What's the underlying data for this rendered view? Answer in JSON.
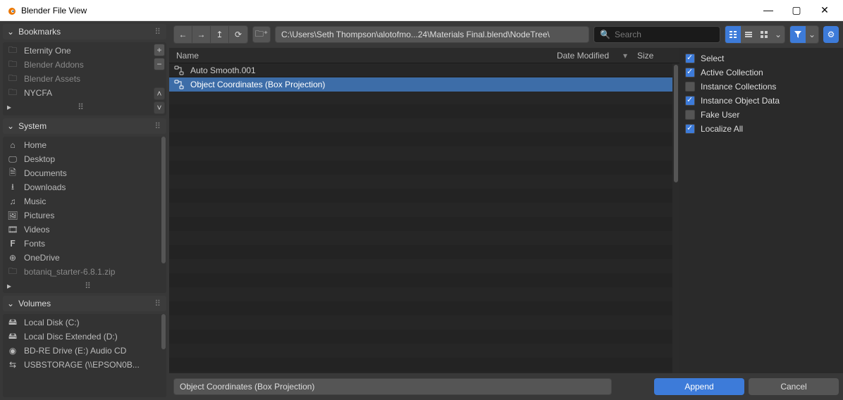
{
  "window": {
    "title": "Blender File View"
  },
  "sidebar": {
    "bookmarks": {
      "header": "Bookmarks",
      "items": [
        {
          "label": "Eternity One",
          "dim": false
        },
        {
          "label": "Blender Addons",
          "dim": true
        },
        {
          "label": "Blender Assets",
          "dim": true
        },
        {
          "label": "NYCFA",
          "dim": false
        }
      ]
    },
    "system": {
      "header": "System",
      "items": [
        {
          "icon": "home",
          "label": "Home"
        },
        {
          "icon": "desktop",
          "label": "Desktop"
        },
        {
          "icon": "documents",
          "label": "Documents"
        },
        {
          "icon": "downloads",
          "label": "Downloads"
        },
        {
          "icon": "music",
          "label": "Music"
        },
        {
          "icon": "pictures",
          "label": "Pictures"
        },
        {
          "icon": "videos",
          "label": "Videos"
        },
        {
          "icon": "fonts",
          "label": "Fonts"
        },
        {
          "icon": "cloud",
          "label": "OneDrive"
        },
        {
          "icon": "folder",
          "label": "botaniq_starter-6.8.1.zip",
          "dim": true
        }
      ]
    },
    "volumes": {
      "header": "Volumes",
      "items": [
        {
          "icon": "disk",
          "label": "Local Disk (C:)"
        },
        {
          "icon": "disk",
          "label": "Local Disc Extended (D:)"
        },
        {
          "icon": "optical",
          "label": "BD-RE Drive (E:) Audio CD"
        },
        {
          "icon": "usb",
          "label": "USBSTORAGE (\\\\EPSON0B..."
        }
      ]
    }
  },
  "toolbar": {
    "path": "C:\\Users\\Seth Thompson\\alotofmo...24\\Materials Final.blend\\NodeTree\\",
    "search_placeholder": "Search"
  },
  "columns": {
    "name": "Name",
    "date": "Date Modified",
    "size": "Size"
  },
  "files": [
    {
      "name": "Auto Smooth.001",
      "selected": false
    },
    {
      "name": "Object Coordinates (Box Projection)",
      "selected": true
    }
  ],
  "options": [
    {
      "label": "Select",
      "checked": true
    },
    {
      "label": "Active Collection",
      "checked": true
    },
    {
      "label": "Instance Collections",
      "checked": false
    },
    {
      "label": "Instance Object Data",
      "checked": true
    },
    {
      "label": "Fake User",
      "checked": false
    },
    {
      "label": "Localize All",
      "checked": true
    }
  ],
  "footer": {
    "filename": "Object Coordinates (Box Projection)",
    "primary": "Append",
    "secondary": "Cancel"
  }
}
